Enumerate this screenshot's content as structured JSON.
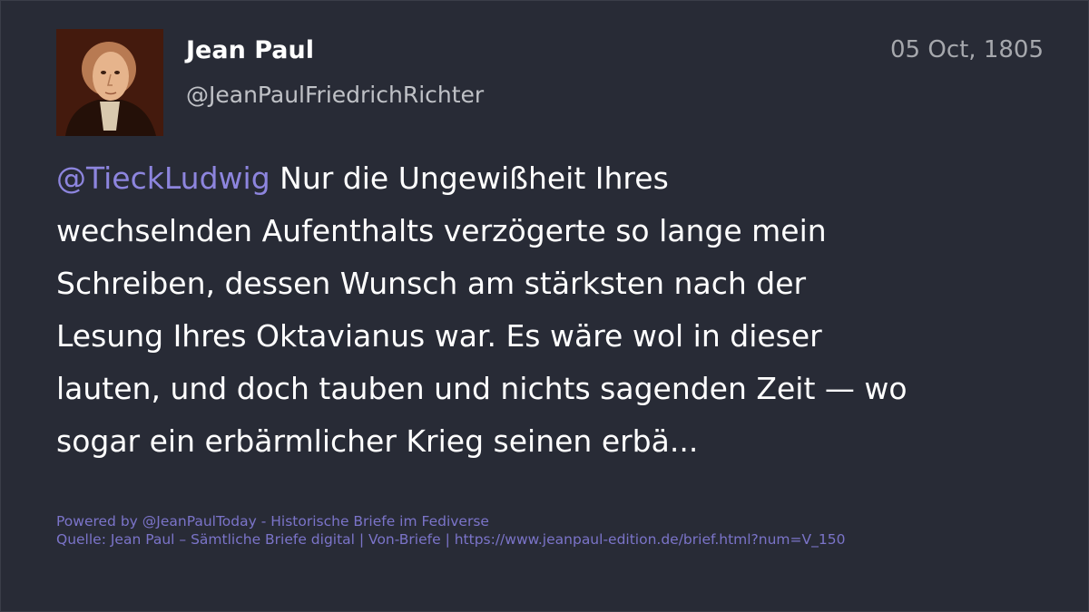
{
  "post": {
    "author_name": "Jean Paul",
    "author_handle": "@JeanPaulFriedrichRichter",
    "date": "05 Oct, 1805",
    "mention": "@TieckLudwig",
    "text_lines": [
      " Nur die Ungewißheit Ihres",
      "wechselnden Aufenthalts verzögerte so lange mein",
      "Schreiben, dessen Wunsch am stärksten nach der",
      "Lesung Ihres Oktavianus war. Es wäre wol in dieser",
      "lauten, und doch tauben und nichts sagenden Zeit — wo",
      "sogar ein erbärmlicher Krieg seinen erbä..."
    ]
  },
  "footer": {
    "powered_by": "Powered by @JeanPaulToday - Historische Briefe im Fediverse",
    "source": "Quelle: Jean Paul – Sämtliche Briefe digital | Von-Briefe | https://www.jeanpaul-edition.de/brief.html?num=V_150"
  },
  "colors": {
    "background": "#282b36",
    "mention": "#8d85de",
    "footer_link": "#7b74c9"
  },
  "icons": {
    "avatar": "portrait-avatar"
  }
}
